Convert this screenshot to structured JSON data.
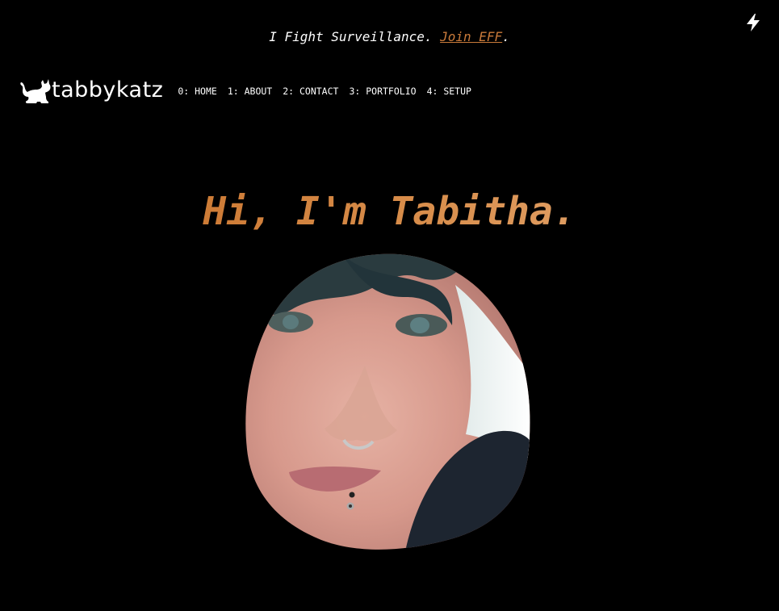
{
  "banner": {
    "text": "I Fight Surveillance. ",
    "link_label": "Join EFF",
    "suffix": "."
  },
  "header": {
    "logo_text": "tabbykatz",
    "nav": [
      {
        "label": "0: HOME"
      },
      {
        "label": "1: ABOUT"
      },
      {
        "label": "2: CONTACT"
      },
      {
        "label": "3: PORTFOLIO"
      },
      {
        "label": "4: SETUP"
      }
    ]
  },
  "hero": {
    "title": "Hi, I'm Tabitha."
  },
  "colors": {
    "background": "#000000",
    "accent": "#c97a3a",
    "title_gradient_start": "#c36a22",
    "title_gradient_end": "#e8b07e"
  },
  "icons": {
    "top_right": "lightning-bolt-icon",
    "logo": "cat-logo-icon"
  }
}
